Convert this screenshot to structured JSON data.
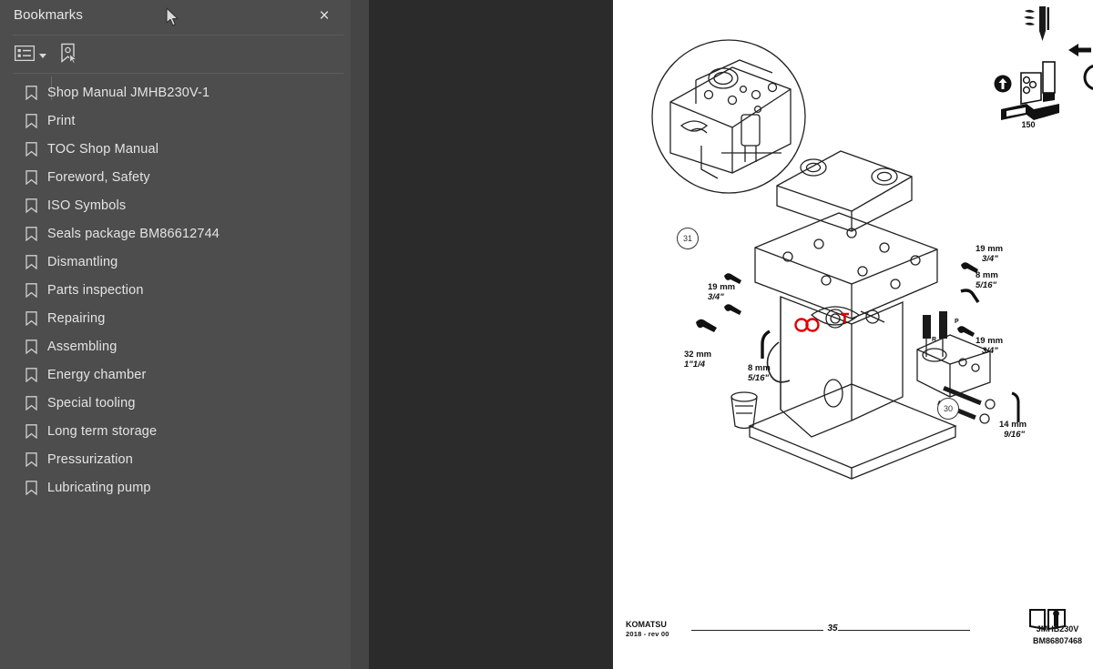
{
  "panel": {
    "title": "Bookmarks",
    "close_label": "×",
    "toolbar": {
      "options_icon": "list-options-icon",
      "options_caret": "chevron-down-icon",
      "new_bookmark_icon": "new-bookmark-icon"
    },
    "items": [
      {
        "label": "Shop Manual JMHB230V-1"
      },
      {
        "label": "Print"
      },
      {
        "label": "TOC Shop Manual"
      },
      {
        "label": "Foreword, Safety"
      },
      {
        "label": "ISO Symbols"
      },
      {
        "label": "Seals package BM86612744"
      },
      {
        "label": "Dismantling"
      },
      {
        "label": "Parts inspection"
      },
      {
        "label": "Repairing"
      },
      {
        "label": "Assembling"
      },
      {
        "label": "Energy chamber"
      },
      {
        "label": "Special tooling"
      },
      {
        "label": "Long term storage"
      },
      {
        "label": "Pressurization"
      },
      {
        "label": "Lubricating pump"
      }
    ]
  },
  "splitter": {
    "collapse_icon": "chevron-left-icon"
  },
  "document": {
    "callouts": [
      {
        "size": "19 mm",
        "frac": "3/4\""
      },
      {
        "size": "32 mm",
        "frac": "1\"1/4"
      },
      {
        "size": "8 mm",
        "frac": "5/16\""
      },
      {
        "size": "19 mm",
        "frac": "3/4\""
      },
      {
        "size": "8 mm",
        "frac": "5/16\""
      },
      {
        "size": "19 mm",
        "frac": "3/4\""
      },
      {
        "size": "14 mm",
        "frac": "9/16\""
      }
    ],
    "balloons": [
      "31",
      "30"
    ],
    "pictogram_value": "150",
    "port_labels": [
      "P",
      "R"
    ],
    "footer": {
      "brand": "KOMATSU",
      "revision": "2018 -  rev 00",
      "page_number": "35",
      "model": "JMHB230V",
      "part_number": "BM86807468"
    }
  },
  "colors": {
    "panel_bg": "#4d4d4d",
    "splitter_bg": "#454545",
    "viewer_bg": "#2b2b2b",
    "page_bg": "#ffffff",
    "text": "#e4e4e4"
  }
}
